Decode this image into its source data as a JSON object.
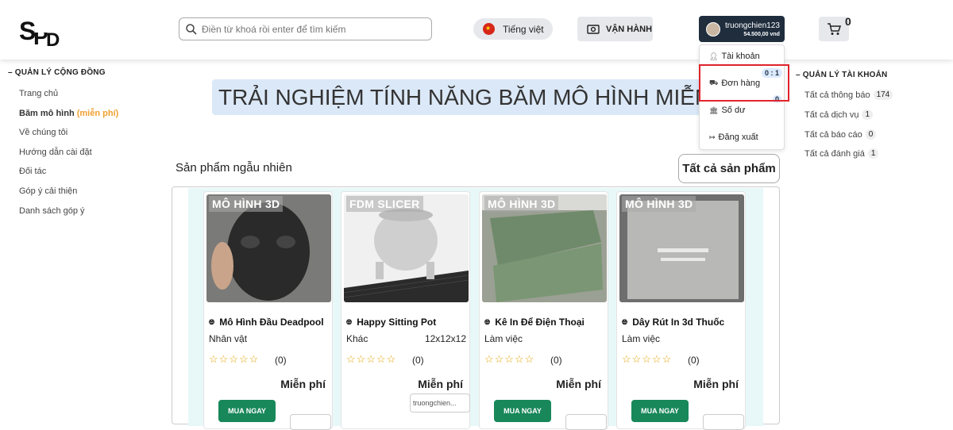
{
  "header": {
    "logo_text": "SPD",
    "search_placeholder": "Điền từ khoá rồi enter để tìm kiếm",
    "language_label": "Tiếng việt",
    "operate_label": "VẬN HÀNH",
    "user": {
      "name": "truongchien123",
      "balance": "54.500,00 vnd"
    },
    "cart_count": "0"
  },
  "user_menu": {
    "items": [
      {
        "label": "Tài khoản",
        "icon": "person-icon"
      },
      {
        "label": "Đơn hàng",
        "icon": "truck-icon",
        "badge": "0 : 1"
      },
      {
        "label": "Số dư",
        "icon": "bank-icon",
        "badge": "0"
      },
      {
        "label": "Đăng xuất",
        "icon": "logout-icon"
      }
    ]
  },
  "left_nav": {
    "title": "QUẢN LÝ CỘNG ĐỒNG",
    "items": [
      "Trang chủ",
      "Băm mô hình",
      "Về chúng tôi",
      "Hướng dẫn cài đặt",
      "Đối tác",
      "Góp ý cải thiện",
      "Danh sách góp ý"
    ],
    "free_tag": "(miễn phí)"
  },
  "right_nav": {
    "title": "QUẢN LÝ TÀI KHOẢN",
    "items": [
      {
        "label": "Tất cả thông báo",
        "count": "174"
      },
      {
        "label": "Tất cả dịch vụ",
        "count": "1"
      },
      {
        "label": "Tất cả báo cáo",
        "count": "0"
      },
      {
        "label": "Tất cả đánh giá",
        "count": "1"
      }
    ]
  },
  "hero_text": "TRẢI NGHIỆM TÍNH NĂNG BĂM MÔ HÌNH MIỄN PHÍ",
  "products_section": {
    "title": "Sản phẩm ngẫu nhiên",
    "all_button": "Tất cả sản phẩm"
  },
  "products": [
    {
      "tag": "MÔ HÌNH 3D",
      "name": "Mô Hình Đầu Deadpool",
      "category": "Nhân vật",
      "size": "",
      "stars": "☆☆☆☆☆",
      "rating_count": "(0)",
      "price": "Miễn phí",
      "buy_label": "MUA NGAY",
      "seller": ""
    },
    {
      "tag": "FDM SLICER",
      "name": "Happy Sitting Pot",
      "category": "Khác",
      "size": "12x12x12",
      "stars": "☆☆☆☆☆",
      "rating_count": "(0)",
      "price": "Miễn phí",
      "buy_label": "",
      "seller": "truongchien..."
    },
    {
      "tag": "MÔ HÌNH 3D",
      "name": "Kê In Để Điện Thoại",
      "category": "Làm việc",
      "size": "",
      "stars": "☆☆☆☆☆",
      "rating_count": "(0)",
      "price": "Miễn phí",
      "buy_label": "MUA NGAY",
      "seller": ""
    },
    {
      "tag": "MÔ HÌNH 3D",
      "name": "Dây Rút In 3d Thuốc",
      "category": "Làm việc",
      "size": "",
      "stars": "☆☆☆☆☆",
      "rating_count": "(0)",
      "price": "Miễn phí",
      "buy_label": "MUA NGAY",
      "seller": ""
    }
  ],
  "colors": {
    "buy_button": "#18875a",
    "highlight_box": "#e0242c",
    "user_button": "#1f2d3d",
    "free_tag": "#f0a030"
  }
}
